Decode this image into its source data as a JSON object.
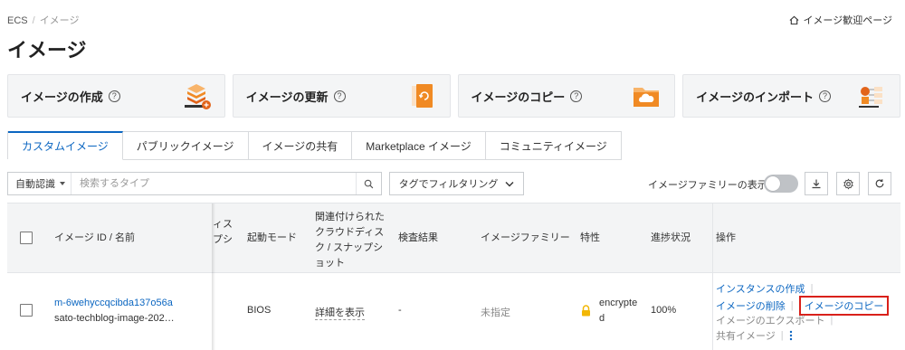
{
  "breadcrumb": {
    "root": "ECS",
    "separator": "/",
    "current": "イメージ"
  },
  "header": {
    "welcome_link": "イメージ歓迎ページ",
    "title": "イメージ"
  },
  "cards": [
    {
      "label": "イメージの作成",
      "help": "?",
      "icon": "stack-layers-icon"
    },
    {
      "label": "イメージの更新",
      "help": "?",
      "icon": "refresh-document-icon"
    },
    {
      "label": "イメージのコピー",
      "help": "?",
      "icon": "cloud-folder-icon"
    },
    {
      "label": "イメージのインポート",
      "help": "?",
      "icon": "import-tree-icon"
    }
  ],
  "tabs": [
    {
      "label": "カスタムイメージ",
      "active": true
    },
    {
      "label": "パブリックイメージ",
      "active": false
    },
    {
      "label": "イメージの共有",
      "active": false
    },
    {
      "label": "Marketplace イメージ",
      "active": false
    },
    {
      "label": "コミュニティイメージ",
      "active": false
    }
  ],
  "toolbar": {
    "type_select": "自動認識",
    "search_placeholder": "検索するタイプ",
    "tag_filter": "タグでフィルタリング",
    "family_toggle_label": "イメージファミリーの表示",
    "family_toggle_on": false
  },
  "table": {
    "columns": {
      "id_name": "イメージ ID / 名前",
      "disk_partial_1": "ィス",
      "disk_partial_2": "プシ",
      "boot_mode": "起動モード",
      "snapshot_1": "関連付けられた",
      "snapshot_2": "クラウドディス",
      "snapshot_3": "ク / スナップシ",
      "snapshot_4": "ョット",
      "check_result": "検査結果",
      "family": "イメージファミリー",
      "feature": "特性",
      "progress": "進捗状況",
      "actions": "操作"
    },
    "row": {
      "image_id": "m-6wehyccqcibda137o56a",
      "image_name": "sato-techblog-image-202…",
      "boot_mode": "BIOS",
      "snapshot": "詳細を表示",
      "check_result": "-",
      "family": "未指定",
      "feature_1": "encrypte",
      "feature_2": "d",
      "progress": "100%",
      "actions": {
        "create_instance": "インスタンスの作成",
        "delete_image": "イメージの削除",
        "copy_image": "イメージのコピー",
        "export_image": "イメージのエクスポート",
        "share_image": "共有イメージ"
      }
    }
  },
  "colors": {
    "accent": "#0b66c1",
    "highlight": "#d9201a",
    "lock": "#f2b705"
  }
}
